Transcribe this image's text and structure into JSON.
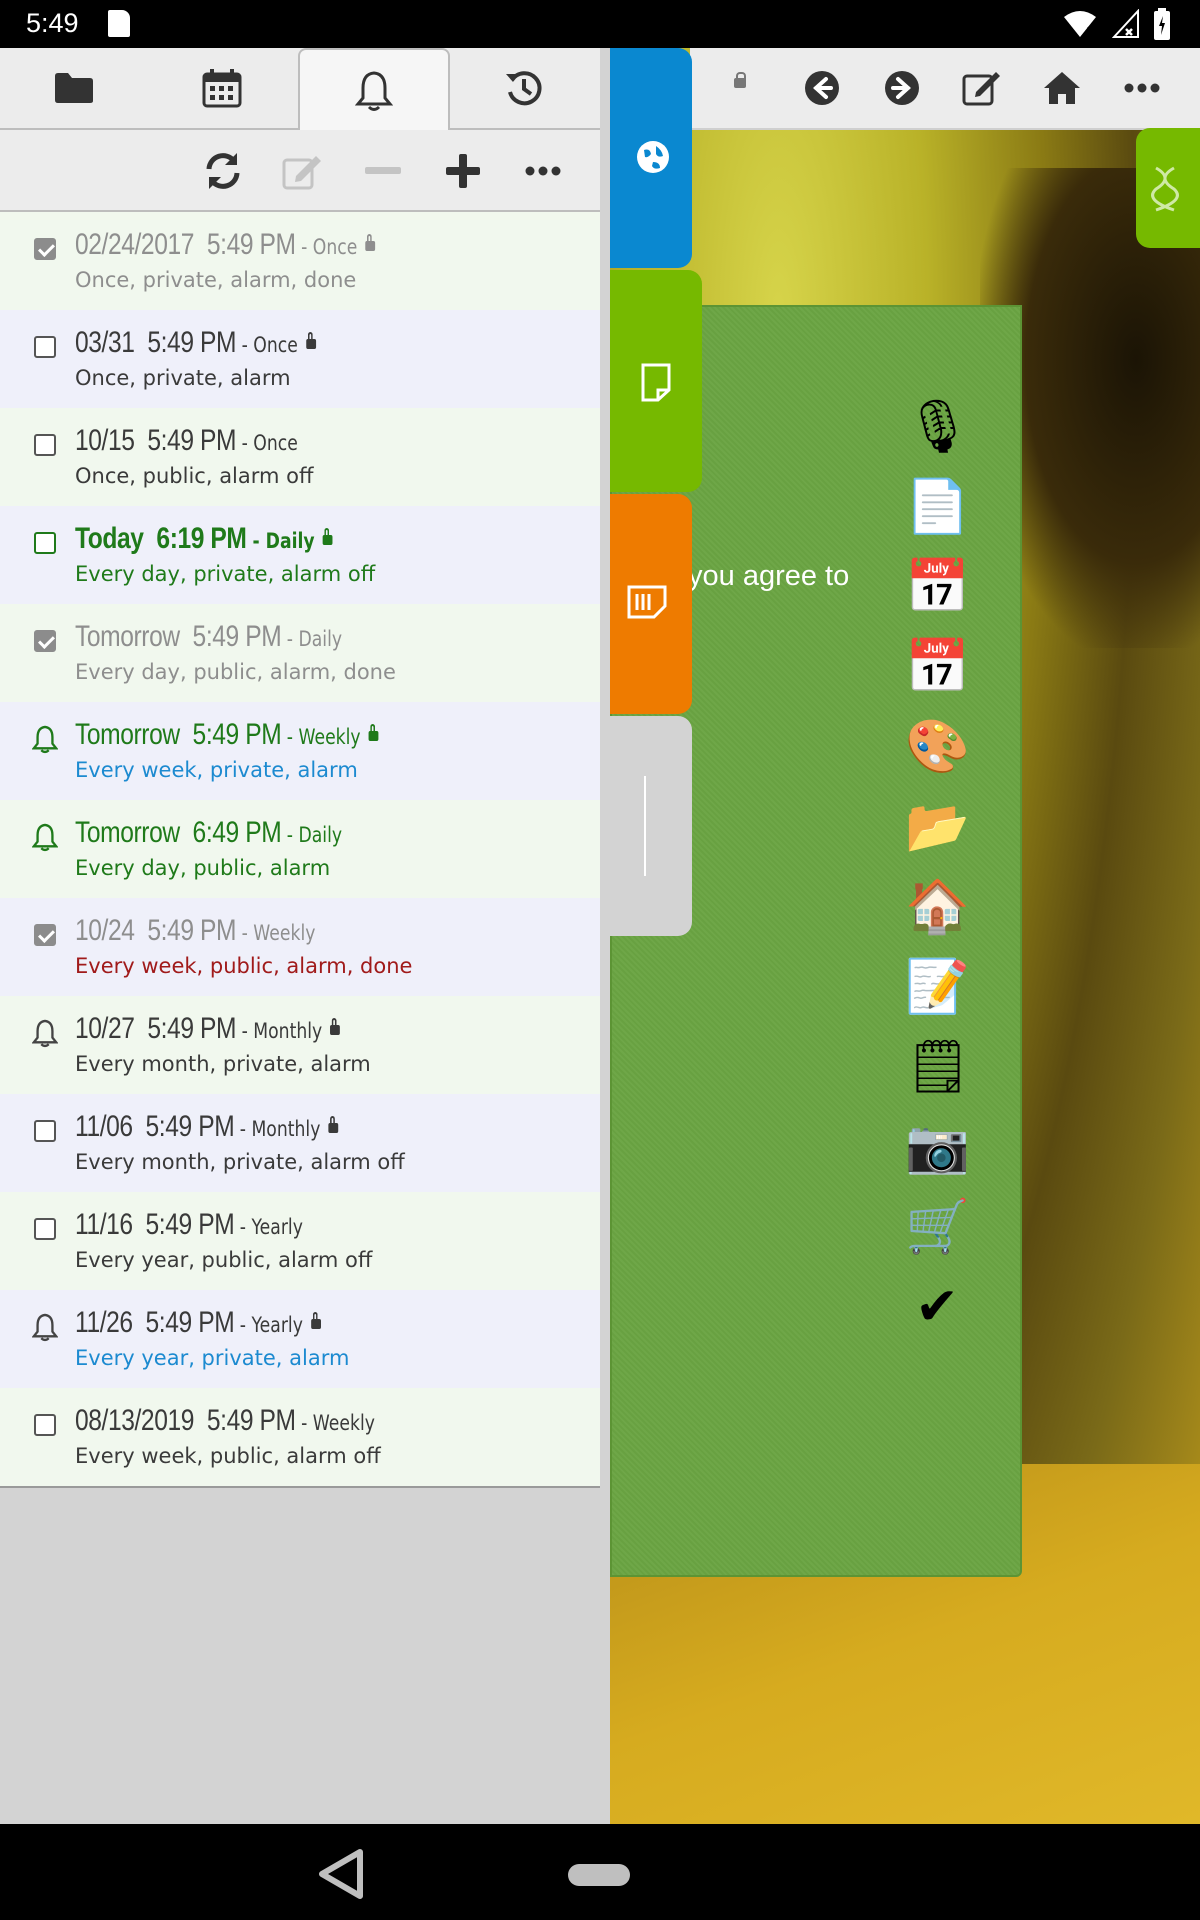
{
  "status_bar": {
    "time": "5:49",
    "icons": [
      "sd-card-icon",
      "wifi-icon",
      "signal-icon",
      "battery-icon"
    ]
  },
  "left_tabs": [
    {
      "icon": "folder-icon",
      "active": false
    },
    {
      "icon": "calendar-icon",
      "active": false
    },
    {
      "icon": "bell-icon",
      "active": true
    },
    {
      "icon": "history-icon",
      "active": false
    }
  ],
  "actions": [
    {
      "icon": "refresh-icon",
      "enabled": true
    },
    {
      "icon": "edit-icon",
      "enabled": false
    },
    {
      "icon": "minus-icon",
      "enabled": false
    },
    {
      "icon": "plus-icon",
      "enabled": true
    },
    {
      "icon": "more-icon",
      "enabled": true
    }
  ],
  "reminders": [
    {
      "state": "checked",
      "when": "02/24/2017  5:49 PM",
      "repeat": " - Once",
      "locked": true,
      "sub": "Once, private, alarm, done",
      "title_color": "#8e8e8e",
      "sub_color": "#8e8e8e"
    },
    {
      "state": "unchecked",
      "when": "03/31  5:49 PM",
      "repeat": " - Once",
      "locked": true,
      "sub": "Once, private, alarm",
      "title_color": "#3a3a3a",
      "sub_color": "#3a3a3a"
    },
    {
      "state": "unchecked",
      "when": "10/15  5:49 PM",
      "repeat": " - Once",
      "locked": false,
      "sub": "Once, public, alarm off",
      "title_color": "#3a3a3a",
      "sub_color": "#3a3a3a"
    },
    {
      "state": "unchecked-green",
      "when": "Today  6:19 PM",
      "repeat": " - Daily",
      "locked": true,
      "sub": "Every day, private, alarm off",
      "title_color": "#1f7a1a",
      "sub_color": "#1f7a1a",
      "bold": true
    },
    {
      "state": "checked",
      "when": "Tomorrow  5:49 PM",
      "repeat": " - Daily",
      "locked": false,
      "sub": "Every day, public, alarm, done",
      "title_color": "#8e8e8e",
      "sub_color": "#8e8e8e"
    },
    {
      "state": "bell-green",
      "when": "Tomorrow  5:49 PM",
      "repeat": " - Weekly",
      "locked": true,
      "sub": "Every week, private, alarm",
      "title_color": "#1f7a1a",
      "sub_color": "#1c8ad0"
    },
    {
      "state": "bell-green",
      "when": "Tomorrow  6:49 PM",
      "repeat": " - Daily",
      "locked": false,
      "sub": "Every day, public, alarm",
      "title_color": "#1f7a1a",
      "sub_color": "#1f7a1a"
    },
    {
      "state": "checked",
      "when": "10/24  5:49 PM",
      "repeat": " - Weekly",
      "locked": false,
      "sub": "Every week, public, alarm, done",
      "title_color": "#8e8e8e",
      "sub_color": "#a01a1a"
    },
    {
      "state": "bell",
      "when": "10/27  5:49 PM",
      "repeat": " - Monthly",
      "locked": true,
      "sub": "Every month, private, alarm",
      "title_color": "#3a3a3a",
      "sub_color": "#3a3a3a"
    },
    {
      "state": "unchecked",
      "when": "11/06  5:49 PM",
      "repeat": " - Monthly",
      "locked": true,
      "sub": "Every month, private, alarm off",
      "title_color": "#3a3a3a",
      "sub_color": "#3a3a3a"
    },
    {
      "state": "unchecked",
      "when": "11/16  5:49 PM",
      "repeat": " - Yearly",
      "locked": false,
      "sub": "Every year, public, alarm off",
      "title_color": "#3a3a3a",
      "sub_color": "#3a3a3a"
    },
    {
      "state": "bell",
      "when": "11/26  5:49 PM",
      "repeat": " - Yearly",
      "locked": true,
      "sub": "Every year, private, alarm",
      "title_color": "#3a3a3a",
      "sub_color": "#1c8ad0"
    },
    {
      "state": "unchecked",
      "when": "08/13/2019  5:49 PM",
      "repeat": " - Weekly",
      "locked": false,
      "sub": "Every week, public, alarm off",
      "title_color": "#3a3a3a",
      "sub_color": "#3a3a3a"
    }
  ],
  "right_toolbar": {
    "icons": [
      "lock-icon",
      "back-icon",
      "forward-icon",
      "edit-note-icon",
      "home-icon",
      "more-icon"
    ]
  },
  "side_tabs": [
    {
      "icon": "globe-icon",
      "color": "#0a88d0"
    },
    {
      "icon": "note-icon",
      "color": "#76b900"
    },
    {
      "icon": "sticky-note-icon",
      "color": "#ee7b00"
    },
    {
      "icon": "blank-tab",
      "color": "#d3d3d3"
    }
  ],
  "card": {
    "partial_text": "you agree to"
  },
  "launcher": [
    "microphone-icon",
    "document-icon",
    "calendar-july-icon",
    "calendar-july-icon",
    "palette-icon",
    "folder-icon",
    "house-icon",
    "memo-icon",
    "notepad-icon",
    "camera-icon",
    "cart-icon",
    "checkmark-icon"
  ],
  "launcher_glyphs": [
    "🎙",
    "📄",
    "📅",
    "📅",
    "🎨",
    "📂",
    "🏠",
    "📝",
    "🗒",
    "📷",
    "🛒",
    "✔"
  ]
}
